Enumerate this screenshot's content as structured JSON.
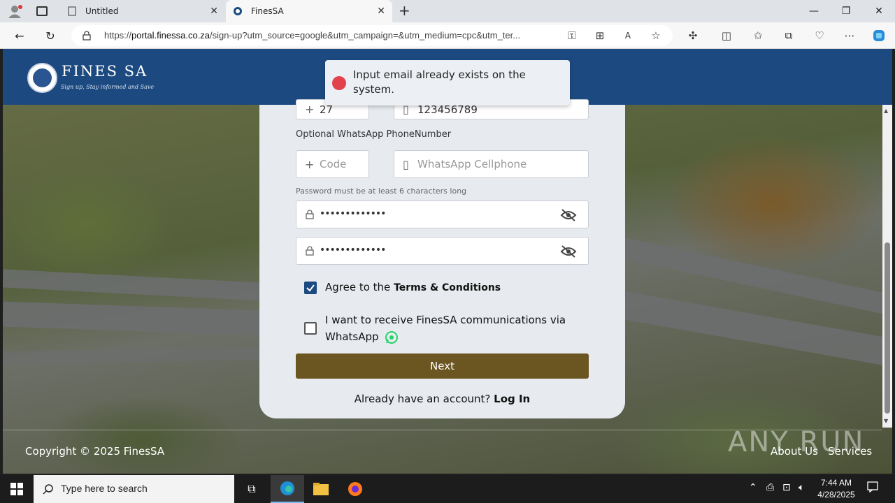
{
  "browser": {
    "tabs": [
      {
        "label": "Untitled"
      },
      {
        "label": "FinesSA"
      }
    ],
    "new_tab": "+",
    "url": {
      "prefix": "https://",
      "host": "portal.finessa.co.za",
      "path": "/sign-up?utm_source=google&utm_campaign=&utm_medium=cpc&utm_ter..."
    },
    "window_controls": {
      "minimize": "—",
      "restore": "❐",
      "close": "✕"
    }
  },
  "header": {
    "logo_title": "FINES SA",
    "logo_tagline": "Sign up, Stay informed and Save"
  },
  "toast": {
    "message": "Input email already exists on the system."
  },
  "form": {
    "phone_code_value": "27",
    "phone_value": "123456789",
    "whatsapp_label": "Optional WhatsApp PhoneNumber",
    "whatsapp_code_placeholder": "Code",
    "whatsapp_phone_placeholder": "WhatsApp Cellphone",
    "password_hint": "Password must be at least 6 characters long",
    "password_value": "•••••••••••••",
    "confirm_password_value": "•••••••••••••",
    "terms_text": "Agree to the ",
    "terms_link": "Terms & Conditions",
    "terms_checked": true,
    "whatsapp_optin_text": "I want to receive FinesSA communications via WhatsApp",
    "whatsapp_optin_checked": false,
    "next_button": "Next",
    "login_prompt": "Already have an account?",
    "login_link": "Log In"
  },
  "footer": {
    "copyright": "Copyright © 2025 FinesSA",
    "links": [
      "About Us",
      "Services"
    ]
  },
  "watermark": "ANY RUN",
  "taskbar": {
    "search_placeholder": "Type here to search",
    "time": "7:44 AM",
    "date": "4/28/2025"
  },
  "colors": {
    "header_blue": "#1c4a80",
    "next_button": "#6b5521",
    "error_red": "#e2424b",
    "whatsapp_green": "#25d366"
  }
}
